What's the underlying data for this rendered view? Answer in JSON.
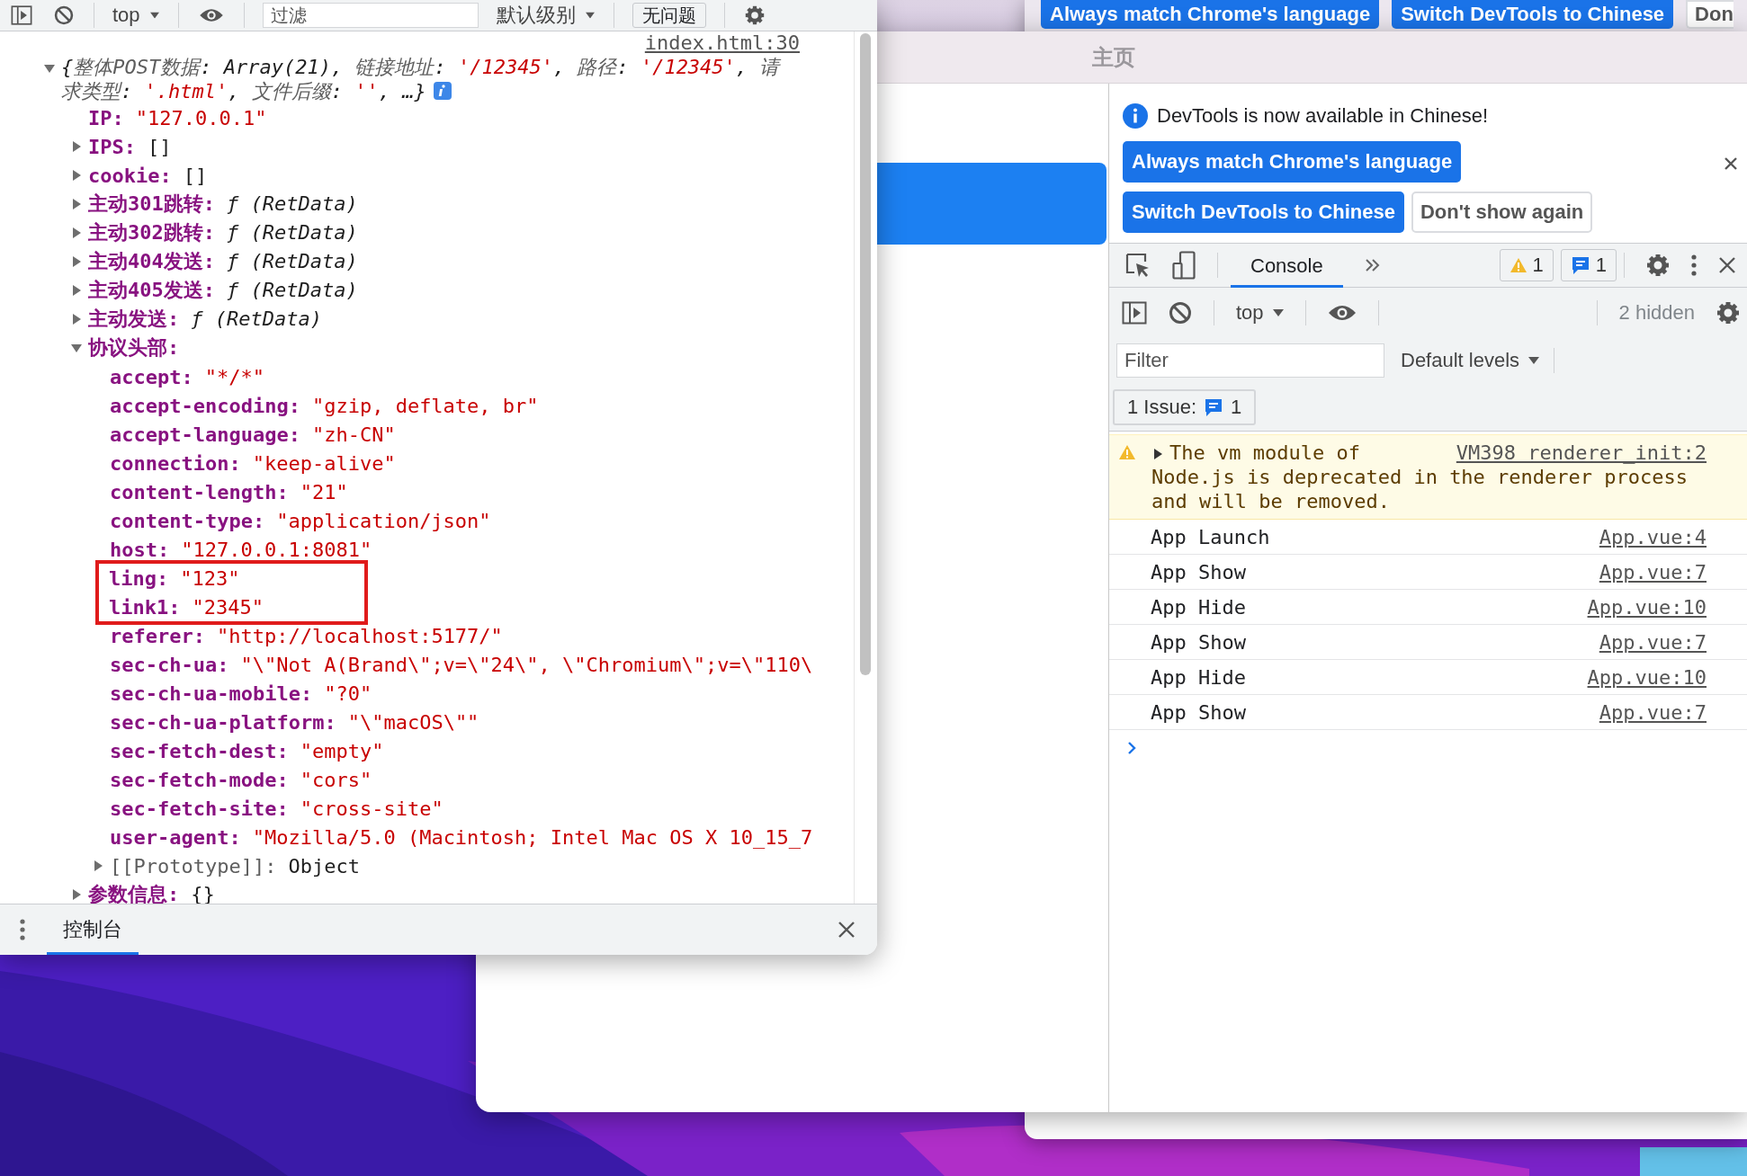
{
  "background_window": {
    "buttons": [
      {
        "label": "Always match Chrome's language",
        "kind": "primary"
      },
      {
        "label": "Switch DevTools to Chinese",
        "kind": "primary"
      },
      {
        "label": "Don",
        "kind": "secondary"
      }
    ]
  },
  "console_window": {
    "toolbar": {
      "context": "top",
      "filter": {
        "placeholder": "过滤"
      },
      "levels": "默认级别",
      "issues": "无问题"
    },
    "log": {
      "source": "index.html:30",
      "expanded": true,
      "summary": [
        {
          "text": "{",
          "kind": "punct"
        },
        {
          "text": "整体POST数据",
          "kind": "key"
        },
        {
          "text": ": Array(21), ",
          "kind": "punct"
        },
        {
          "text": "链接地址",
          "kind": "key"
        },
        {
          "text": ": ",
          "kind": "punct"
        },
        {
          "text": "'/12345'",
          "kind": "string"
        },
        {
          "text": ", ",
          "kind": "punct"
        },
        {
          "text": "路径",
          "kind": "key"
        },
        {
          "text": ": ",
          "kind": "punct"
        },
        {
          "text": "'/12345'",
          "kind": "string"
        },
        {
          "text": ", ",
          "kind": "punct"
        },
        {
          "text": "请求类型",
          "kind": "key"
        },
        {
          "text": ": ",
          "kind": "punct"
        },
        {
          "text": "'.html'",
          "kind": "string"
        },
        {
          "text": ", ",
          "kind": "punct"
        },
        {
          "text": "文件后缀",
          "kind": "key"
        },
        {
          "text": ": ",
          "kind": "punct"
        },
        {
          "text": "''",
          "kind": "string"
        },
        {
          "text": ", …}",
          "kind": "punct"
        }
      ],
      "properties": [
        {
          "key": "IP:",
          "value": "\"127.0.0.1\"",
          "kind": "string"
        },
        {
          "key": "IPS:",
          "value": "[]",
          "kind": "object",
          "expanded": false
        },
        {
          "key": "cookie:",
          "value": "[]",
          "kind": "object",
          "expanded": false
        },
        {
          "key": "主动301跳转:",
          "value": "ƒ (RetData)",
          "kind": "function",
          "expanded": false
        },
        {
          "key": "主动302跳转:",
          "value": "ƒ (RetData)",
          "kind": "function",
          "expanded": false
        },
        {
          "key": "主动404发送:",
          "value": "ƒ (RetData)",
          "kind": "function",
          "expanded": false
        },
        {
          "key": "主动405发送:",
          "value": "ƒ (RetData)",
          "kind": "function",
          "expanded": false
        },
        {
          "key": "主动发送:",
          "value": "ƒ (RetData)",
          "kind": "function",
          "expanded": false
        },
        {
          "key": "协议头部:",
          "kind": "object",
          "expanded": true,
          "children": [
            {
              "key": "accept:",
              "value": "\"*/*\"",
              "kind": "string",
              "boxed": false
            },
            {
              "key": "accept-encoding:",
              "value": "\"gzip, deflate, br\"",
              "kind": "string",
              "boxed": false
            },
            {
              "key": "accept-language:",
              "value": "\"zh-CN\"",
              "kind": "string",
              "boxed": false
            },
            {
              "key": "connection:",
              "value": "\"keep-alive\"",
              "kind": "string",
              "boxed": false
            },
            {
              "key": "content-length:",
              "value": "\"21\"",
              "kind": "string",
              "boxed": false
            },
            {
              "key": "content-type:",
              "value": "\"application/json\"",
              "kind": "string",
              "boxed": false
            },
            {
              "key": "host:",
              "value": "\"127.0.0.1:8081\"",
              "kind": "string",
              "boxed": false
            },
            {
              "key": "ling:",
              "value": "\"123\"",
              "kind": "string",
              "boxed": true
            },
            {
              "key": "link1:",
              "value": "\"2345\"",
              "kind": "string",
              "boxed": true
            },
            {
              "key": "referer:",
              "value": "\"http://localhost:5177/\"",
              "kind": "string",
              "boxed": false
            },
            {
              "key": "sec-ch-ua:",
              "value": "\"\\\"Not A(Brand\\\";v=\\\"24\\\", \\\"Chromium\\\";v=\\\"110\\",
              "kind": "string",
              "boxed": false
            },
            {
              "key": "sec-ch-ua-mobile:",
              "value": "\"?0\"",
              "kind": "string",
              "boxed": false
            },
            {
              "key": "sec-ch-ua-platform:",
              "value": "\"\\\"macOS\\\"\"",
              "kind": "string",
              "boxed": false
            },
            {
              "key": "sec-fetch-dest:",
              "value": "\"empty\"",
              "kind": "string",
              "boxed": false
            },
            {
              "key": "sec-fetch-mode:",
              "value": "\"cors\"",
              "kind": "string",
              "boxed": false
            },
            {
              "key": "sec-fetch-site:",
              "value": "\"cross-site\"",
              "kind": "string",
              "boxed": false
            },
            {
              "key": "user-agent:",
              "value": "\"Mozilla/5.0 (Macintosh; Intel Mac OS X 10_15_7",
              "kind": "string",
              "boxed": false
            },
            {
              "key": "[[Prototype]]:",
              "value": "Object",
              "kind": "internal",
              "expanded": false,
              "boxed": false
            }
          ]
        },
        {
          "key": "参数信息:",
          "value": "{}",
          "kind": "object",
          "expanded": false
        }
      ]
    },
    "drawer": {
      "tabs": [
        {
          "label": "控制台",
          "selected": true
        }
      ]
    }
  },
  "app_window": {
    "title": "主页",
    "devtools": {
      "banner": {
        "message": "DevTools is now available in Chinese!",
        "buttons": [
          {
            "label": "Always match Chrome's language",
            "kind": "primary"
          },
          {
            "label": "Switch DevTools to Chinese",
            "kind": "primary"
          },
          {
            "label": "Don't show again",
            "kind": "secondary"
          }
        ]
      },
      "tabs": [
        {
          "label": "Console",
          "selected": true
        }
      ],
      "counts": {
        "warnings": "1",
        "messages": "1"
      },
      "console_toolbar": {
        "context": "top",
        "hidden": "2 hidden"
      },
      "filter": {
        "placeholder": "Filter"
      },
      "levels": "Default levels",
      "issues": {
        "label": "1 Issue:",
        "count": "1"
      },
      "messages": [
        {
          "kind": "warning",
          "text": "The vm module of Node.js is deprecated in the renderer process and will be removed.",
          "source": "VM398 renderer_init:2",
          "expanded": false
        },
        {
          "kind": "log",
          "text": "App Launch",
          "source": "App.vue:4"
        },
        {
          "kind": "log",
          "text": "App Show",
          "source": "App.vue:7"
        },
        {
          "kind": "log",
          "text": "App Hide",
          "source": "App.vue:10"
        },
        {
          "kind": "log",
          "text": "App Show",
          "source": "App.vue:7"
        },
        {
          "kind": "log",
          "text": "App Hide",
          "source": "App.vue:10"
        },
        {
          "kind": "log",
          "text": "App Show",
          "source": "App.vue:7"
        }
      ]
    }
  }
}
